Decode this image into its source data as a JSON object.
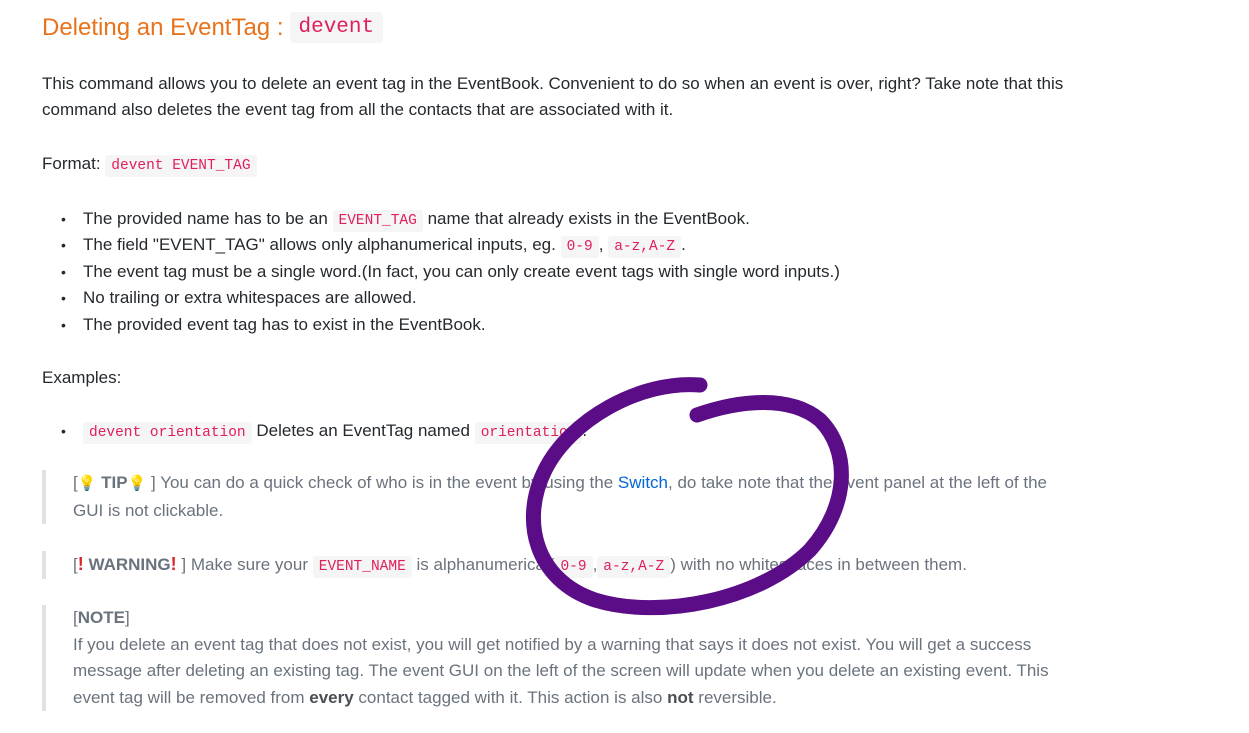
{
  "heading": {
    "text": "Deleting an EventTag :",
    "code": "devent"
  },
  "intro": {
    "line1": "This command allows you to delete an event tag in the EventBook. Convenient to do so when an event is over, right? Take note that this",
    "line2": "command also deletes the event tag from all the contacts that are associated with it."
  },
  "format": {
    "label": "Format:",
    "code": "devent EVENT_TAG"
  },
  "bullets": {
    "b1_pre": "The provided name has to be an",
    "b1_code": "EVENT_TAG",
    "b1_post": "name that already exists in the EventBook.",
    "b2_pre": "The field \"EVENT_TAG\" allows only alphanumerical inputs, eg.",
    "b2_code1": "0-9",
    "b2_sep": ",",
    "b2_code2": "a-z,A-Z",
    "b2_post": ".",
    "b3": "The event tag must be a single word.(In fact, you can only create event tags with single word inputs.)",
    "b4": "No trailing or extra whitespaces are allowed.",
    "b5": "The provided event tag has to exist in the EventBook."
  },
  "examples": {
    "label": "Examples:",
    "e1_code": "devent orientation",
    "e1_text": "Deletes an EventTag named",
    "e1_code2": "orientation",
    "e1_post": "."
  },
  "tip": {
    "open": "[",
    "label": "TIP",
    "close": "]",
    "text_pre": "You can do a quick check of who is in the event by using the",
    "link": "Switch",
    "text_post": ", do take note that the event panel at the left of the",
    "line2": "GUI is not clickable."
  },
  "warning": {
    "open": "[",
    "label": "WARNING",
    "close": "]",
    "pre": "Make sure your",
    "code": "EVENT_NAME",
    "mid": "is alphanumerical(",
    "code2": "0-9",
    "sep": ",",
    "code3": "a-z,A-Z",
    "post": ") with no whitespaces in between them."
  },
  "note": {
    "label_open": "[",
    "label": "NOTE",
    "label_close": "]",
    "line1": "If you delete an event tag that does not exist, you will get notified by a warning that says it does not exist. You will get a success",
    "line2": "message after deleting an existing tag. The event GUI on the left of the screen will update when you delete an existing event. This",
    "line3_pre": "event tag will be removed from",
    "line3_b1": "every",
    "line3_mid": "contact tagged with it. This action is also",
    "line3_b2": "not",
    "line3_post": "reversible."
  },
  "colors": {
    "heading": "#e8731c",
    "code": "#e01e5a",
    "link": "#0366d6",
    "annotation": "#5b0c87"
  },
  "icons": [
    "lightbulb-icon",
    "exclamation-icon",
    "hand-drawn-circle"
  ]
}
